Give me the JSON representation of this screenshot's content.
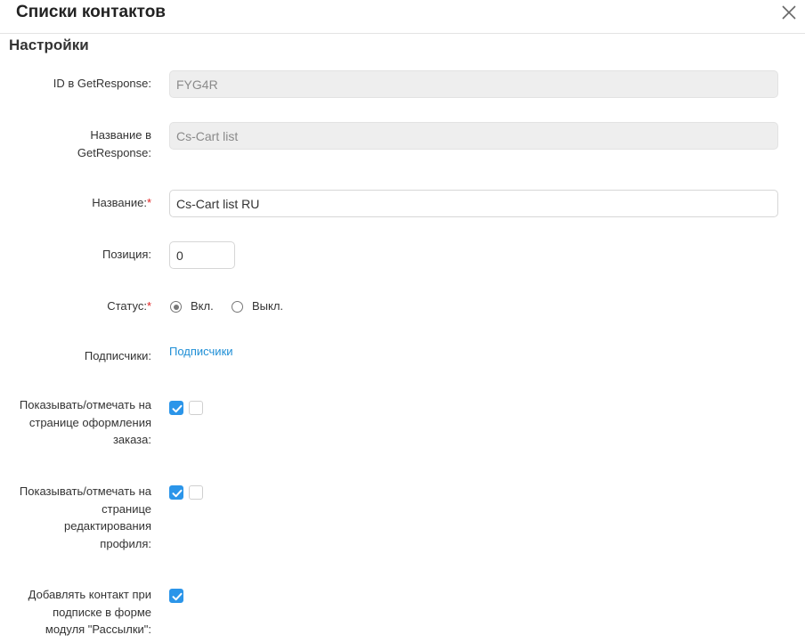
{
  "dialog": {
    "title": "Списки контактов",
    "close_icon": "close-icon"
  },
  "section": {
    "title": "Настройки"
  },
  "fields": {
    "getresponse_id": {
      "label": "ID в GetResponse:",
      "value": "FYG4R",
      "disabled": true
    },
    "getresponse_name": {
      "label_line1": "Название в",
      "label_line2": "GetResponse:",
      "value": "Cs-Cart list",
      "disabled": true
    },
    "name": {
      "label": "Название:",
      "required_mark": "*",
      "value": "Cs-Cart list RU"
    },
    "position": {
      "label": "Позиция:",
      "value": "0"
    },
    "status": {
      "label": "Статус:",
      "required_mark": "*",
      "options": [
        {
          "label": "Вкл.",
          "selected": true
        },
        {
          "label": "Выкл.",
          "selected": false
        }
      ]
    },
    "subscribers": {
      "label": "Подписчики:",
      "link_text": "Подписчики"
    },
    "checkout": {
      "label_line1": "Показывать/отмечать на",
      "label_line2": "странице оформления",
      "label_line3": "заказа:",
      "show_checked": true,
      "mark_checked": false
    },
    "profile": {
      "label_line1": "Показывать/отмечать на",
      "label_line2": "странице",
      "label_line3": "редактирования",
      "label_line4": "профиля:",
      "show_checked": true,
      "mark_checked": false
    },
    "newsletter": {
      "label_line1": "Добавлять контакт при",
      "label_line2": "подписке в форме",
      "label_line3": "модуля \"Рассылки\":",
      "checked": true
    }
  },
  "colors": {
    "accent": "#2b95e9",
    "link": "#1f8fd6",
    "required": "#e02020",
    "disabled_bg": "#eeeeee"
  }
}
